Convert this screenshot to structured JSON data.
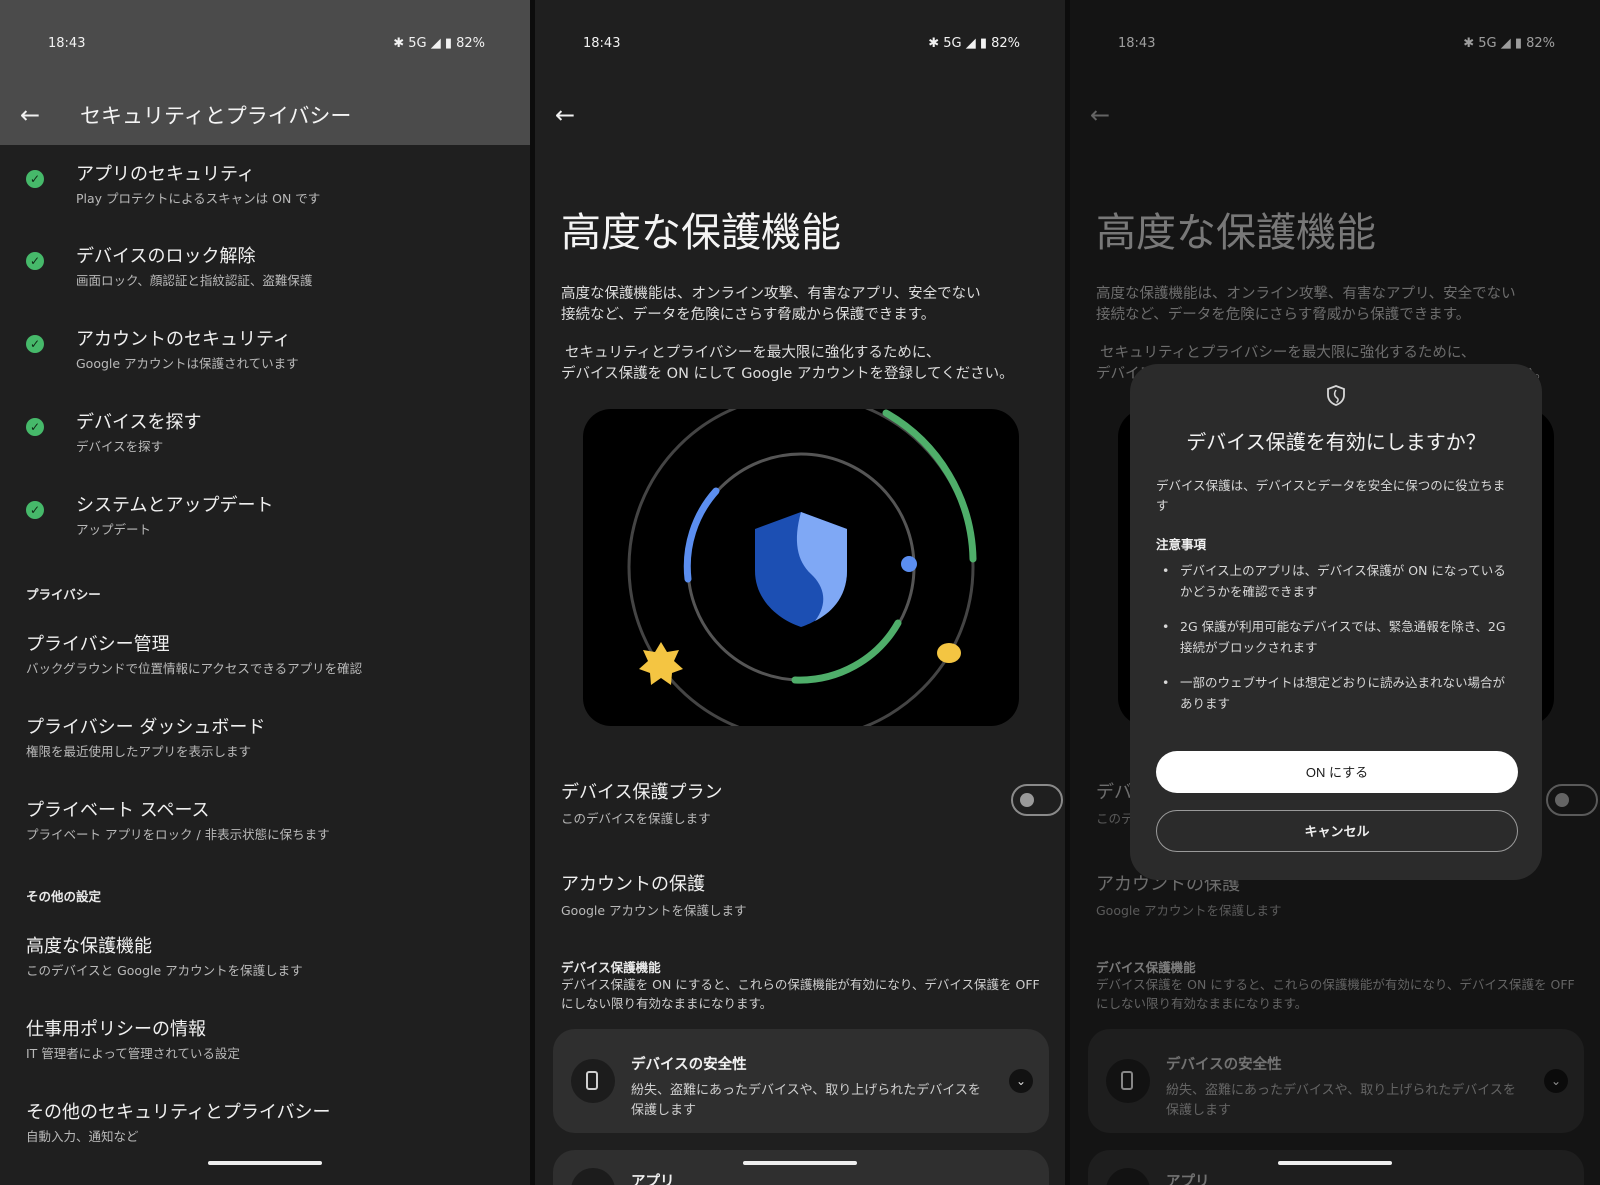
{
  "status": {
    "time": "18:43",
    "indicators": "✱ 5G ◢ ▮ 82%"
  },
  "settings_list": {
    "title": "セキュリティとプライバシー",
    "security_items": [
      {
        "title": "アプリのセキュリティ",
        "subtitle": "Play プロテクトによるスキャンは ON です"
      },
      {
        "title": "デバイスのロック解除",
        "subtitle": "画面ロック、顔認証と指紋認証、盗難保護"
      },
      {
        "title": "アカウントのセキュリティ",
        "subtitle": "Google アカウントは保護されています"
      },
      {
        "title": "デバイスを探す",
        "subtitle": "デバイスを探す"
      },
      {
        "title": "システムとアップデート",
        "subtitle": "アップデート"
      }
    ],
    "privacy_header": "プライバシー",
    "privacy_items": [
      {
        "title": "プライバシー管理",
        "subtitle": "バックグラウンドで位置情報にアクセスできるアプリを確認"
      },
      {
        "title": "プライバシー ダッシュボード",
        "subtitle": "権限を最近使用したアプリを表示します"
      },
      {
        "title": "プライベート スペース",
        "subtitle": "プライベート アプリをロック / 非表示状態に保ちます"
      }
    ],
    "other_header": "その他の設定",
    "other_items": [
      {
        "title": "高度な保護機能",
        "subtitle": "このデバイスと Google アカウントを保護します"
      },
      {
        "title": "仕事用ポリシーの情報",
        "subtitle": "IT 管理者によって管理されている設定"
      },
      {
        "title": "その他のセキュリティとプライバシー",
        "subtitle": "自動入力、通知など"
      }
    ]
  },
  "advanced": {
    "title": "高度な保護機能",
    "desc_line1": "高度な保護機能は、オンライン攻撃、有害なアプリ、安全でない",
    "desc_line2": "接続など、データを危険にさらす脅威から保護できます。",
    "desc2_line1": "セキュリティとプライバシーを最大限に強化するために、",
    "desc2_line2": "デバイス保護を ON にして Google アカウントを登録してください。",
    "plan_title": "デバイス保護プラン",
    "plan_subtitle": "このデバイスを保護します",
    "plan_enabled": false,
    "account_title": "アカウントの保護",
    "account_subtitle": "Google アカウントを保護します",
    "features_header": "デバイス保護機能",
    "features_line1": "デバイス保護を ON にすると、これらの保護機能が有効になり、デバイス保護を OFF",
    "features_line2": "にしない限り有効なままになります。",
    "card_title": "デバイスの安全性",
    "card_line1": "紛失、盗難にあったデバイスや、取り上げられたデバイスを",
    "card_line2": "保護します",
    "card2_title": "アプリ"
  },
  "dialog": {
    "title": "デバイス保護を有効にしますか？",
    "body": "デバイス保護は、デバイスとデータを安全に保つのに役立ちます",
    "note_header": "注意事項",
    "bullets": [
      "デバイス上のアプリは、デバイス保護が ON になっているかどうかを確認できます",
      "2G 保護が利用可能なデバイスでは、緊急通報を除き、2G 接続がブロックされます",
      "一部のウェブサイトは想定どおりに読み込まれない場合があります"
    ],
    "on_button": "ON にする",
    "cancel_button": "キャンセル"
  },
  "colors": {
    "check_green": "#46b96a",
    "accent_blue": "#5b8ef0",
    "arc_green": "#4fae6a",
    "sun_yellow": "#f4c542"
  }
}
